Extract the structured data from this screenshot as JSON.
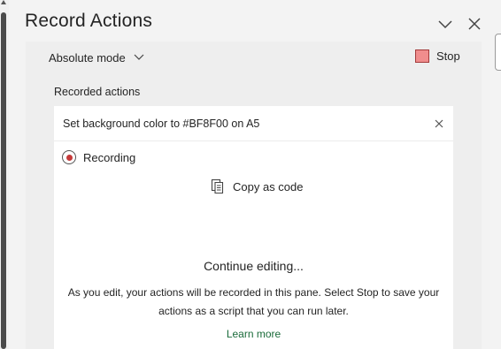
{
  "pane": {
    "title": "Record Actions"
  },
  "mode": {
    "label": "Absolute mode"
  },
  "stop": {
    "label": "Stop"
  },
  "recorded": {
    "label": "Recorded actions",
    "actions": [
      {
        "text": "Set background color to #BF8F00 on A5"
      }
    ]
  },
  "recording": {
    "label": "Recording"
  },
  "copy": {
    "label": "Copy as code"
  },
  "info": {
    "title": "Continue editing...",
    "description": "As you edit, your actions will be recorded in this pane. Select Stop to save your actions as a script that you can run later.",
    "link": "Learn more"
  },
  "colors": {
    "stop_fill": "#f08d8d",
    "record_dot": "#c53a3a",
    "link": "#1a6b3a"
  }
}
